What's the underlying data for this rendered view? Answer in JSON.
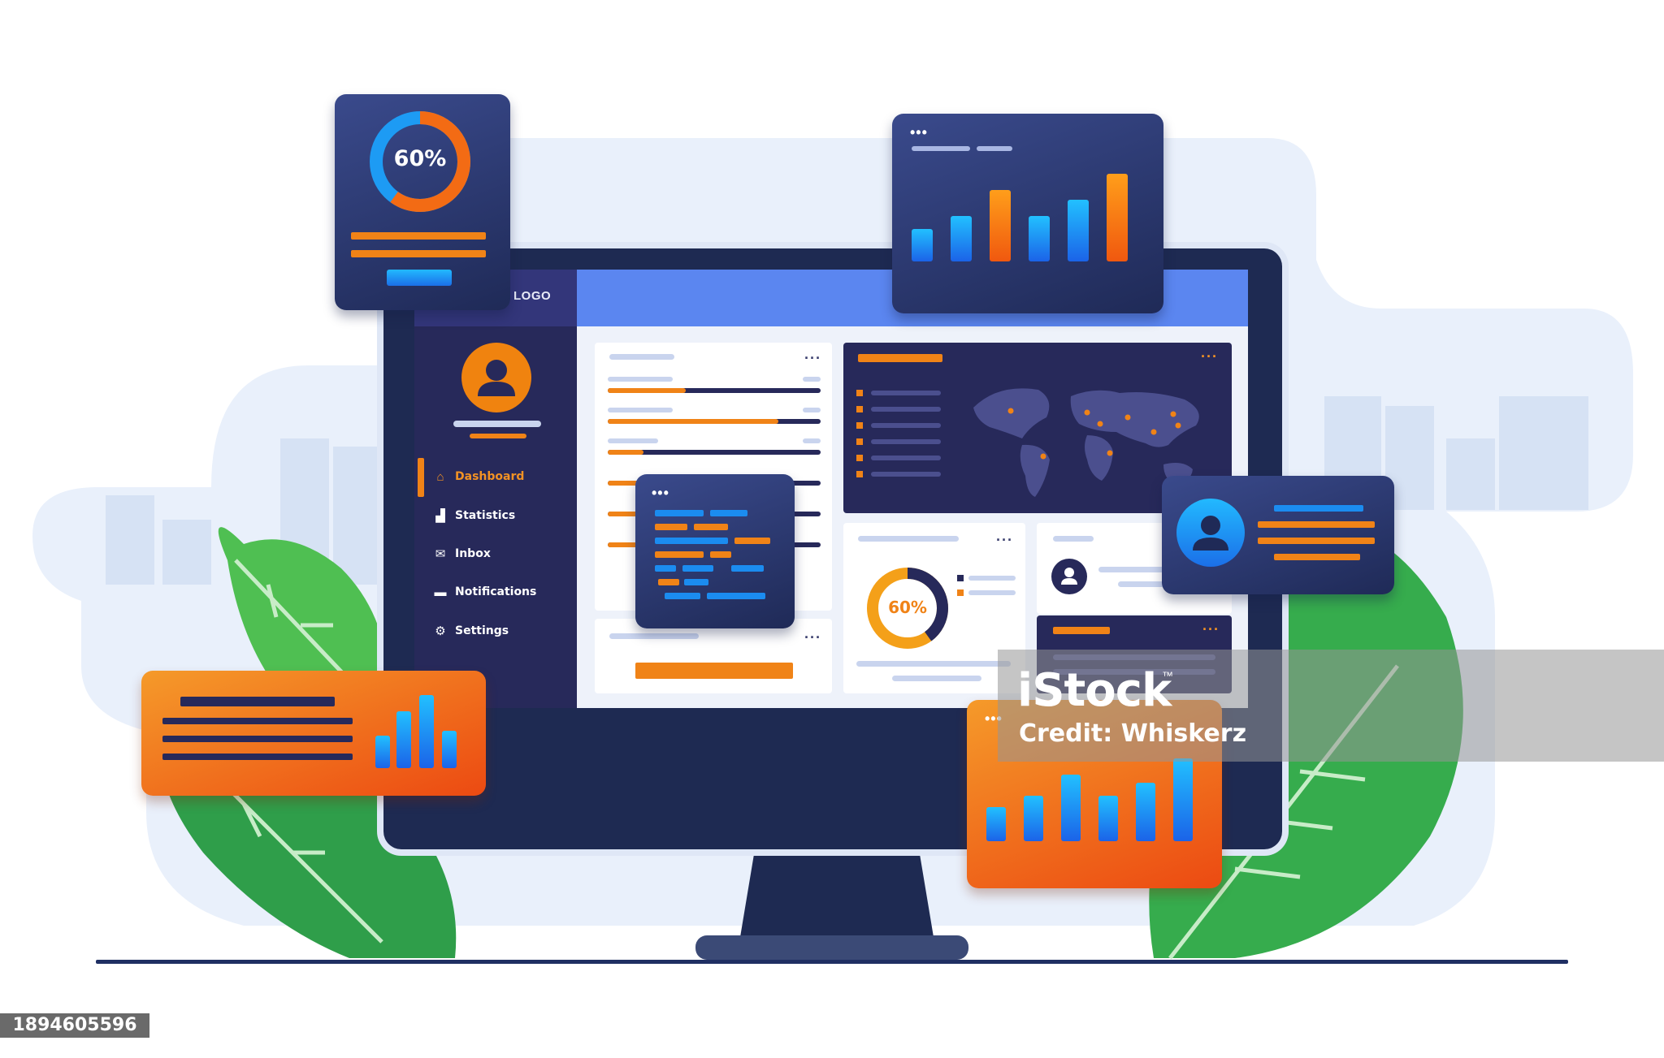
{
  "screen": {
    "logo_text": "LOGO",
    "nav": [
      {
        "label": "Dashboard",
        "icon": "home-icon",
        "active": true
      },
      {
        "label": "Statistics",
        "icon": "bar-chart-icon",
        "active": false
      },
      {
        "label": "Inbox",
        "icon": "mail-icon",
        "active": false
      },
      {
        "label": "Notifications",
        "icon": "chat-icon",
        "active": false
      },
      {
        "label": "Settings",
        "icon": "gear-icon",
        "active": false
      }
    ],
    "donut_label": "60%"
  },
  "floating_progress_card": {
    "label": "60%",
    "progress": 0.6
  },
  "watermark": {
    "brand": "iStock",
    "trademark": "™",
    "credit": "Credit: Whiskerz"
  },
  "stock_id": "1894605596",
  "colors": {
    "navy": "#27295a",
    "orange": "#f0830f",
    "blue": "#1b8cf0",
    "accent_top": "#5b86f0"
  }
}
